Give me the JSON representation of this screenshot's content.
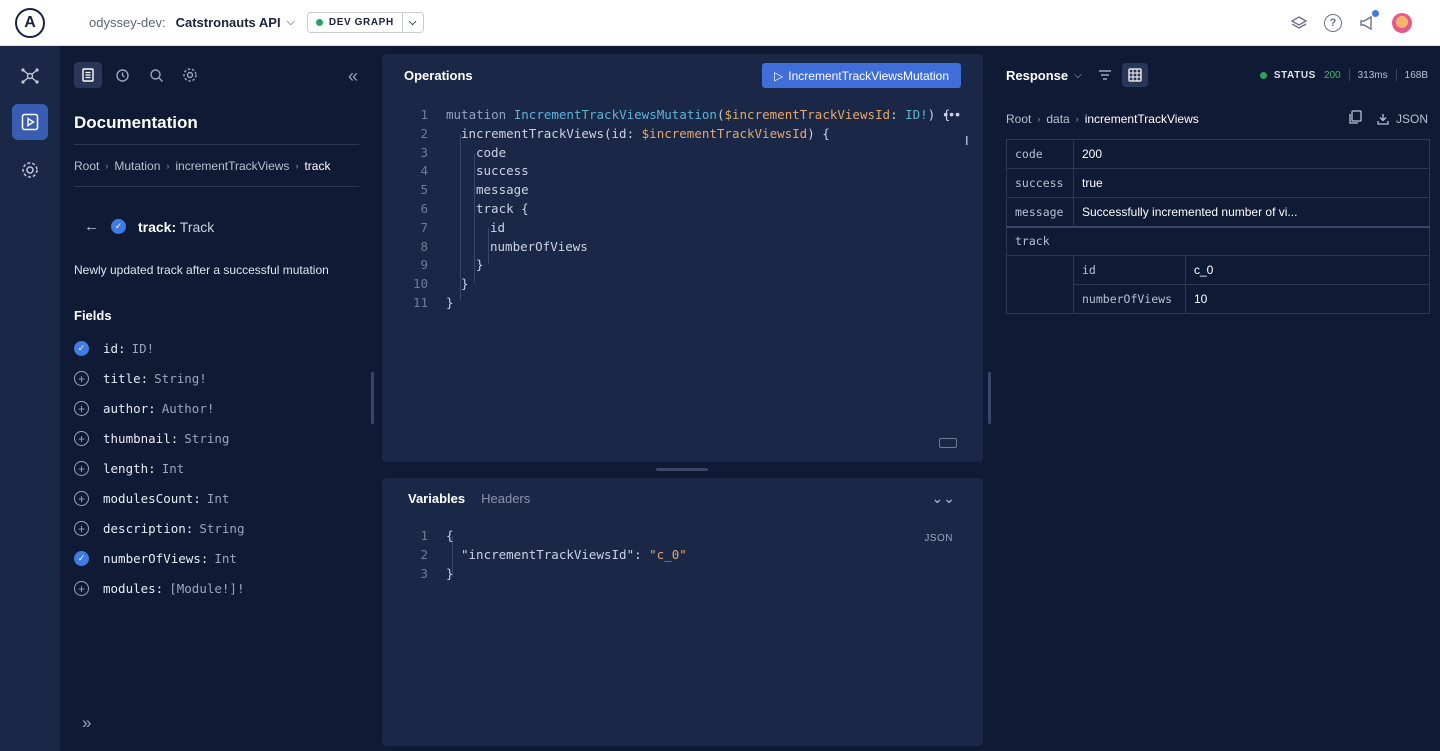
{
  "topbar": {
    "logo_letter": "A",
    "org": "odyssey-dev:",
    "graph": "Catstronauts API",
    "variant": "DEV GRAPH"
  },
  "doc": {
    "title": "Documentation",
    "breadcrumbs": [
      "Root",
      "Mutation",
      "incrementTrackViews",
      "track"
    ],
    "selected_name": "track:",
    "selected_type": "Track",
    "description": "Newly updated track after a successful mutation",
    "fields_title": "Fields",
    "fields": [
      {
        "name": "id:",
        "type": "ID!",
        "selected": true
      },
      {
        "name": "title:",
        "type": "String!",
        "selected": false
      },
      {
        "name": "author:",
        "type": "Author!",
        "selected": false
      },
      {
        "name": "thumbnail:",
        "type": "String",
        "selected": false
      },
      {
        "name": "length:",
        "type": "Int",
        "selected": false
      },
      {
        "name": "modulesCount:",
        "type": "Int",
        "selected": false
      },
      {
        "name": "description:",
        "type": "String",
        "selected": false
      },
      {
        "name": "numberOfViews:",
        "type": "Int",
        "selected": true
      },
      {
        "name": "modules:",
        "type": "[Module!]!",
        "selected": false
      }
    ]
  },
  "operations": {
    "title": "Operations",
    "run_label": "IncrementTrackViewsMutation",
    "line_numbers": [
      "1",
      "2",
      "3",
      "4",
      "5",
      "6",
      "7",
      "8",
      "9",
      "10",
      "11"
    ],
    "code": {
      "mutation_kw": "mutation",
      "op_name": "IncrementTrackViewsMutation",
      "var_name": "$incrementTrackViewsId",
      "var_type": "ID!",
      "field_call": "incrementTrackViews",
      "arg_name": "id:",
      "f_code": "code",
      "f_success": "success",
      "f_message": "message",
      "f_track": "track",
      "f_id": "id",
      "f_views": "numberOfViews"
    }
  },
  "variables": {
    "tabs": [
      "Variables",
      "Headers"
    ],
    "format": "JSON",
    "line_numbers": [
      "1",
      "2",
      "3"
    ],
    "key": "\"incrementTrackViewsId\"",
    "value": "\"c_0\""
  },
  "response": {
    "title": "Response",
    "status_label": "STATUS",
    "status_code": "200",
    "time": "313ms",
    "size": "168B",
    "breadcrumbs": [
      "Root",
      "data",
      "incrementTrackViews"
    ],
    "format": "JSON",
    "rows": [
      {
        "key": "code",
        "value": "200"
      },
      {
        "key": "success",
        "value": "true"
      },
      {
        "key": "message",
        "value": "Successfully incremented number of vi..."
      }
    ],
    "nested_key": "track",
    "nested_rows": [
      {
        "key": "id",
        "value": "c_0"
      },
      {
        "key": "numberOfViews",
        "value": "10"
      }
    ]
  },
  "colors": {
    "accent": "#3f6ed8",
    "background": "#0f1a35",
    "panel": "#1b2747",
    "status_green": "#2f9e5f"
  }
}
